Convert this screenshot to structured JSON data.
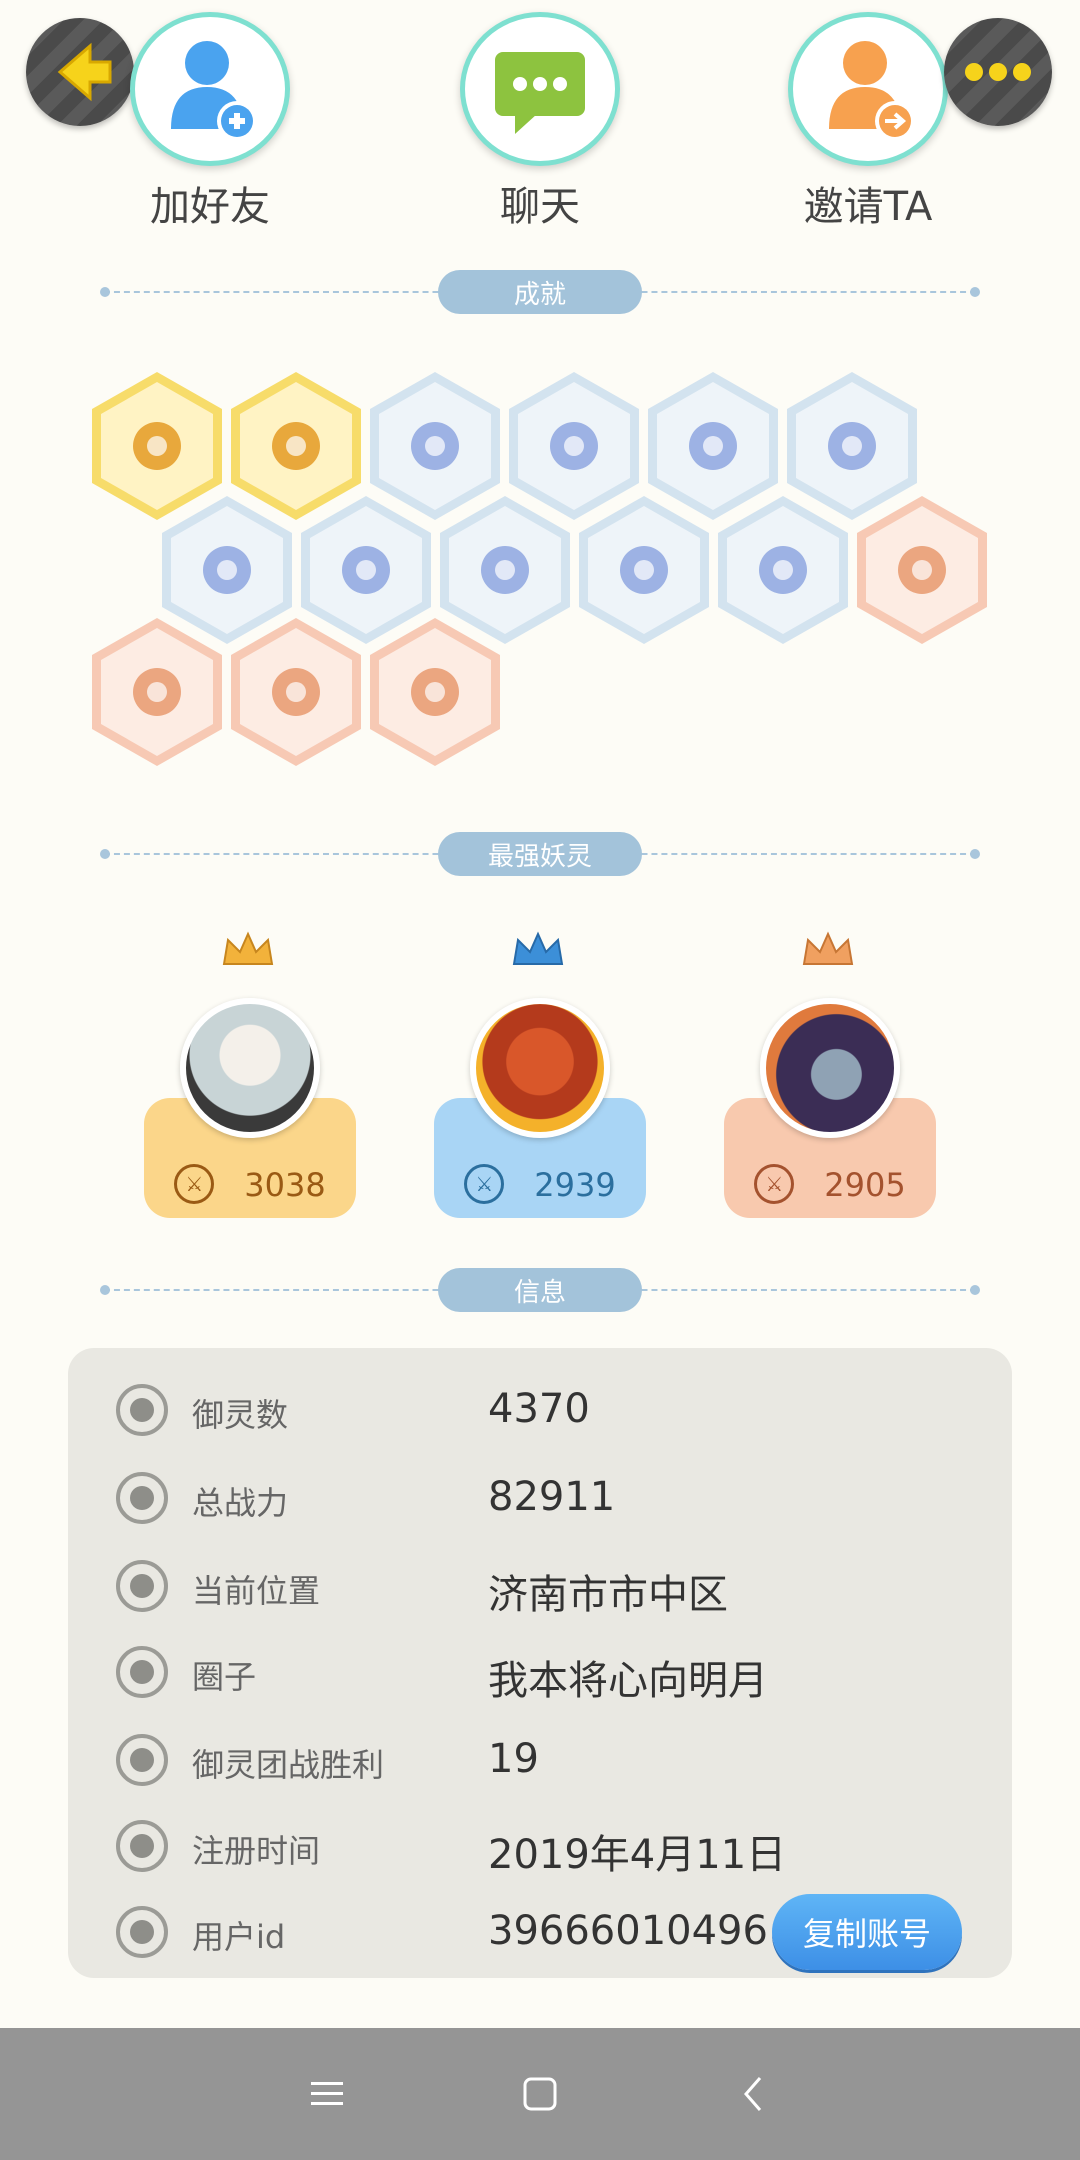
{
  "top_actions": {
    "add_friend": "加好友",
    "chat": "聊天",
    "invite": "邀请TA"
  },
  "sections": {
    "achievements": "成就",
    "strongest_spirits": "最强妖灵",
    "info": "信息"
  },
  "achievements": [
    {
      "tier": "gold",
      "icon": "cat-face-icon"
    },
    {
      "tier": "gold",
      "icon": "fox-pup-icon"
    },
    {
      "tier": "blue",
      "icon": "winged-shoe-icon"
    },
    {
      "tier": "blue",
      "icon": "orb-portal-icon"
    },
    {
      "tier": "blue",
      "icon": "moon-icon"
    },
    {
      "tier": "blue",
      "icon": "crystal-ball-icon"
    },
    {
      "tier": "blue",
      "icon": "crystal-stone-icon"
    },
    {
      "tier": "blue",
      "icon": "yin-yang-swirl-icon"
    },
    {
      "tier": "blue",
      "icon": "monk-figure-icon"
    },
    {
      "tier": "blue",
      "icon": "yin-yang-book-icon"
    },
    {
      "tier": "blue",
      "icon": "open-book-fox-icon"
    },
    {
      "tier": "peach",
      "icon": "cat-cart-icon"
    },
    {
      "tier": "peach",
      "icon": "koi-fish-icon"
    },
    {
      "tier": "peach",
      "icon": "shield-emblem-icon"
    },
    {
      "tier": "peach",
      "icon": "demon-statue-icon"
    }
  ],
  "spirits": [
    {
      "power": "3038",
      "crown_color": "#f2b23b"
    },
    {
      "power": "2939",
      "crown_color": "#3c8fd8"
    },
    {
      "power": "2905",
      "crown_color": "#f0a060"
    }
  ],
  "info": {
    "rows": [
      {
        "label": "御灵数",
        "value": "4370",
        "icon": "spirit-count-icon"
      },
      {
        "label": "总战力",
        "value": "82911",
        "icon": "sword-icon"
      },
      {
        "label": "当前位置",
        "value": "济南市市中区",
        "icon": "location-pin-icon"
      },
      {
        "label": "圈子",
        "value": "我本将心向明月",
        "icon": "circle-group-icon"
      },
      {
        "label": "御灵团战胜利",
        "value": "19",
        "icon": "anchor-icon"
      },
      {
        "label": "注册时间",
        "value": "2019年4月11日",
        "icon": "clock-icon"
      },
      {
        "label": "用户id",
        "value": "39666010496",
        "icon": "id-card-icon"
      }
    ],
    "copy_button": "复制账号"
  },
  "colors": {
    "accent_blue": "#3d8fe6",
    "divider_pill": "#a3c3da",
    "panel_bg": "#e9e8e2"
  }
}
